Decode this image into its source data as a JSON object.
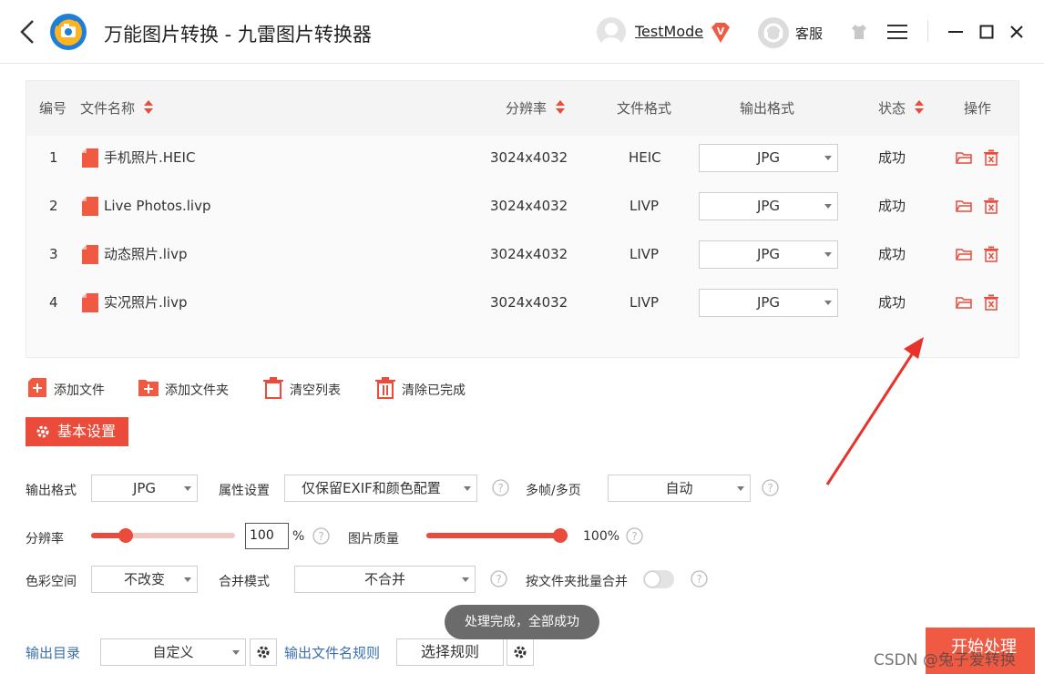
{
  "header": {
    "back_label": "back",
    "title": "万能图片转换 - 九雷图片转换器",
    "user_name": "TestMode",
    "vip_badge": "V",
    "service_label": "客服"
  },
  "table": {
    "columns": {
      "index": "编号",
      "name": "文件名称",
      "resolution": "分辨率",
      "file_format": "文件格式",
      "output_format": "输出格式",
      "status": "状态",
      "action": "操作"
    },
    "rows": [
      {
        "index": "1",
        "name": "手机照片.HEIC",
        "resolution": "3024x4032",
        "format": "HEIC",
        "output": "JPG",
        "status": "成功"
      },
      {
        "index": "2",
        "name": "Live Photos.livp",
        "resolution": "3024x4032",
        "format": "LIVP",
        "output": "JPG",
        "status": "成功"
      },
      {
        "index": "3",
        "name": "动态照片.livp",
        "resolution": "3024x4032",
        "format": "LIVP",
        "output": "JPG",
        "status": "成功"
      },
      {
        "index": "4",
        "name": "实况照片.livp",
        "resolution": "3024x4032",
        "format": "LIVP",
        "output": "JPG",
        "status": "成功"
      }
    ]
  },
  "toolbar": {
    "add_file": "添加文件",
    "add_folder": "添加文件夹",
    "clear_list": "清空列表",
    "clear_done": "清除已完成"
  },
  "settings": {
    "section_title": "基本设置",
    "output_format_label": "输出格式",
    "output_format_value": "JPG",
    "attr_label": "属性设置",
    "attr_value": "仅保留EXIF和颜色配置",
    "multiframe_label": "多帧/多页",
    "multiframe_value": "自动",
    "resolution_label": "分辨率",
    "resolution_value": "100",
    "resolution_unit": "%",
    "resolution_slider_fraction": 0.24,
    "quality_label": "图片质量",
    "quality_value": "100%",
    "quality_slider_fraction": 1.0,
    "color_space_label": "色彩空间",
    "color_space_value": "不改变",
    "merge_label": "合并模式",
    "merge_value": "不合并",
    "batch_merge_label": "按文件夹批量合并",
    "batch_merge_on": false,
    "output_dir_label": "输出目录",
    "output_dir_value": "自定义",
    "name_rule_label": "输出文件名规则",
    "name_rule_button": "选择规则"
  },
  "toast": "处理完成，全部成功",
  "start_button": "开始处理",
  "watermark": "CSDN @兔子爱转换",
  "colors": {
    "accent": "#ea4b3a",
    "file_icon": "#f05a43",
    "link_blue": "#3a6fb0",
    "arrow": "#e8332a"
  }
}
